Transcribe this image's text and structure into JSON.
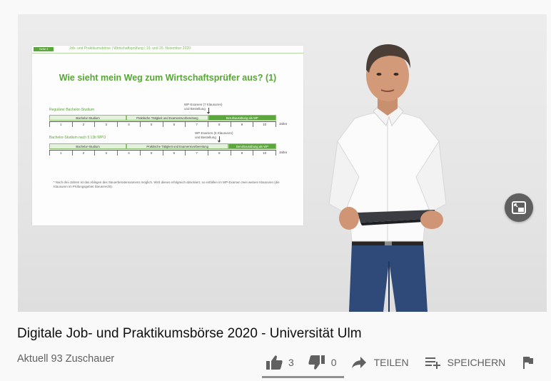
{
  "video": {
    "slide": {
      "tag": "Seite 4",
      "header": "Job- und Praktikumsbörse | Wirtschaftsprüfung | 19. und 20. November 2020",
      "title": "Wie sieht mein Weg zum Wirtschaftsprüfer aus? (1)",
      "section1": {
        "label": "Regulärer Bachelor-Studium",
        "wp_label_line1": "WP-Examen (7 Klausuren)",
        "wp_label_line2": "und Bestellung",
        "segments": [
          "Bachelor-Studium",
          "Praktische Tätigkeit und Examensvorbereitung",
          "Berufsausübung als WP"
        ]
      },
      "section2": {
        "label": "Bachelor-Studium nach § 13b WPO",
        "wp_label_line1": "WP-Examen (5 Klausuren)",
        "wp_label_line2": "und Bestellung",
        "segments": [
          "Bachelor-Studium",
          "Praktische Tätigkeit und Examensvorbereitung",
          "Berufsausübung als WP"
        ]
      },
      "years": [
        "1",
        "2",
        "3",
        "4",
        "5",
        "6",
        "7",
        "8",
        "9",
        "10"
      ],
      "years_unit": "Jahre",
      "footnote": "* Nach drei Jahren ist das Ablegen des Steuerberaterexamens möglich. Wird dieses erfolgreich absolviert, so entfallen im WP-Examen zwei weitere Klausuren (die Klausuren im Prüfungsgebiet Steuerrecht)."
    }
  },
  "title": "Digitale Job- und Praktikumsbörse 2020 - Universität Ulm",
  "viewers": "Aktuell 93 Zuschauer",
  "actions": {
    "like_count": "3",
    "dislike_count": "0",
    "share_label": "TEILEN",
    "save_label": "SPEICHERN"
  },
  "like_ratio": 1.0,
  "icons": {
    "pip": "picture-in-picture-icon",
    "like": "thumbs-up-icon",
    "dislike": "thumbs-down-icon",
    "share": "share-arrow-icon",
    "save": "playlist-add-icon",
    "report": "flag-icon"
  }
}
